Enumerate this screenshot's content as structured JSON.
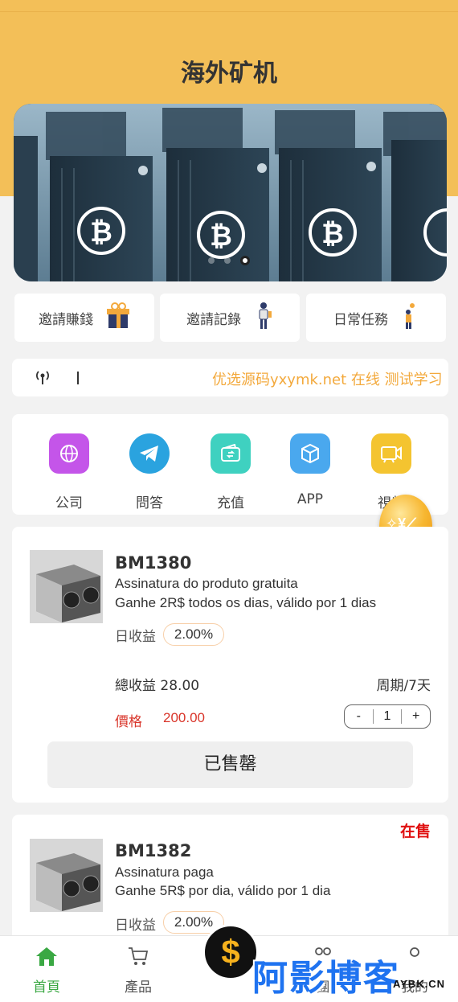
{
  "header": {
    "title": "海外矿机"
  },
  "banner": {
    "slide_count": 3,
    "active_slide": 3
  },
  "quick_links": [
    {
      "label": "邀請賺錢",
      "icon": "gift-icon"
    },
    {
      "label": "邀請記錄",
      "icon": "person-icon"
    },
    {
      "label": "日常任務",
      "icon": "task-icon"
    }
  ],
  "notice": {
    "icon": "broadcast-icon",
    "text": "优选源码yxymk.net 在线 测试学习"
  },
  "menu": [
    {
      "label": "公司",
      "icon": "globe-icon",
      "color": "#c455e9"
    },
    {
      "label": "問答",
      "icon": "telegram-icon",
      "color": "#2aa3df"
    },
    {
      "label": "充值",
      "icon": "wallet-icon",
      "color": "#3fd1c0"
    },
    {
      "label": "APP",
      "icon": "cube-icon",
      "color": "#4aa8ee"
    },
    {
      "label": "視頻",
      "icon": "video-icon",
      "color": "#f4c430"
    }
  ],
  "products": [
    {
      "name": "BM1380",
      "line1": "Assinatura do produto gratuita",
      "line2": "Ganhe 2R$ todos os dias, válido por 1 dias",
      "rate_label": "日收益",
      "rate": "2.00%",
      "total": "總收益 28.00",
      "period": "周期/7天",
      "price_label": "價格",
      "price": "200.00",
      "qty_minus": "-",
      "qty": "1",
      "qty_plus": "+",
      "button": "已售罄"
    },
    {
      "name": "BM1382",
      "status": "在售",
      "line1": "Assinatura paga",
      "line2": "Ganhe 5R$ por dia, válido por 1 dia",
      "rate_label": "日收益",
      "rate": "2.00%"
    }
  ],
  "tabbar": [
    {
      "label": "首頁",
      "icon": "home-icon",
      "active": true
    },
    {
      "label": "產品",
      "icon": "cart-icon",
      "active": false
    },
    {
      "label": "團",
      "icon": "team-icon",
      "active": false
    },
    {
      "label": "我的",
      "icon": "user-icon",
      "active": false
    }
  ],
  "float_button": {
    "symbol": "$"
  },
  "watermark": {
    "text": "阿影博客",
    "sub": "AYBK.CN"
  },
  "colors": {
    "header": "#f3bf58",
    "accent": "#3aa843",
    "price": "#d9362b",
    "notice": "#f3a93c"
  }
}
